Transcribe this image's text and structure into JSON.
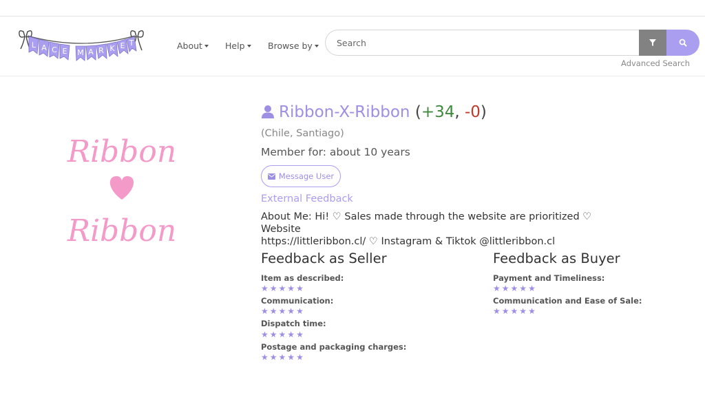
{
  "header": {
    "logo_text": "LACE MARKET",
    "nav": [
      {
        "label": "About"
      },
      {
        "label": "Help"
      },
      {
        "label": "Browse by"
      }
    ],
    "search": {
      "placeholder": "Search",
      "value": ""
    },
    "advanced_search": "Advanced Search",
    "icons": {
      "filter": "filter-icon",
      "search": "search-icon"
    }
  },
  "profile": {
    "image_text": [
      "Ribbon",
      "Ribbon"
    ],
    "username": "Ribbon-X-Ribbon",
    "score_open": "(",
    "positive": "+34",
    "separator": ", ",
    "negative": "-0",
    "score_close": ")",
    "location": "(Chile, Santiago)",
    "member_for": "Member for: about 10 years",
    "message_button": "Message User",
    "external_feedback": "External Feedback",
    "about_line1": "About Me: Hi! ♡ Sales made through the website are prioritized ♡ Website",
    "about_line2": "https://littleribbon.cl/ ♡ Instagram & Tiktok @littleribbon.cl"
  },
  "feedback_seller": {
    "title": "Feedback as Seller",
    "items": [
      {
        "label": "Item as described:",
        "rating": 5
      },
      {
        "label": "Communication:",
        "rating": 5
      },
      {
        "label": "Dispatch time:",
        "rating": 5
      },
      {
        "label": "Postage and packaging charges:",
        "rating": 5
      }
    ]
  },
  "feedback_buyer": {
    "title": "Feedback as Buyer",
    "items": [
      {
        "label": "Payment and Timeliness:",
        "rating": 5
      },
      {
        "label": "Communication and Ease of Sale:",
        "rating": 5
      }
    ]
  },
  "colors": {
    "accent": "#a99ef0",
    "link": "#9d8fe3",
    "positive": "#3f8a3f",
    "negative": "#c0392b",
    "pink": "#f49ac9"
  }
}
